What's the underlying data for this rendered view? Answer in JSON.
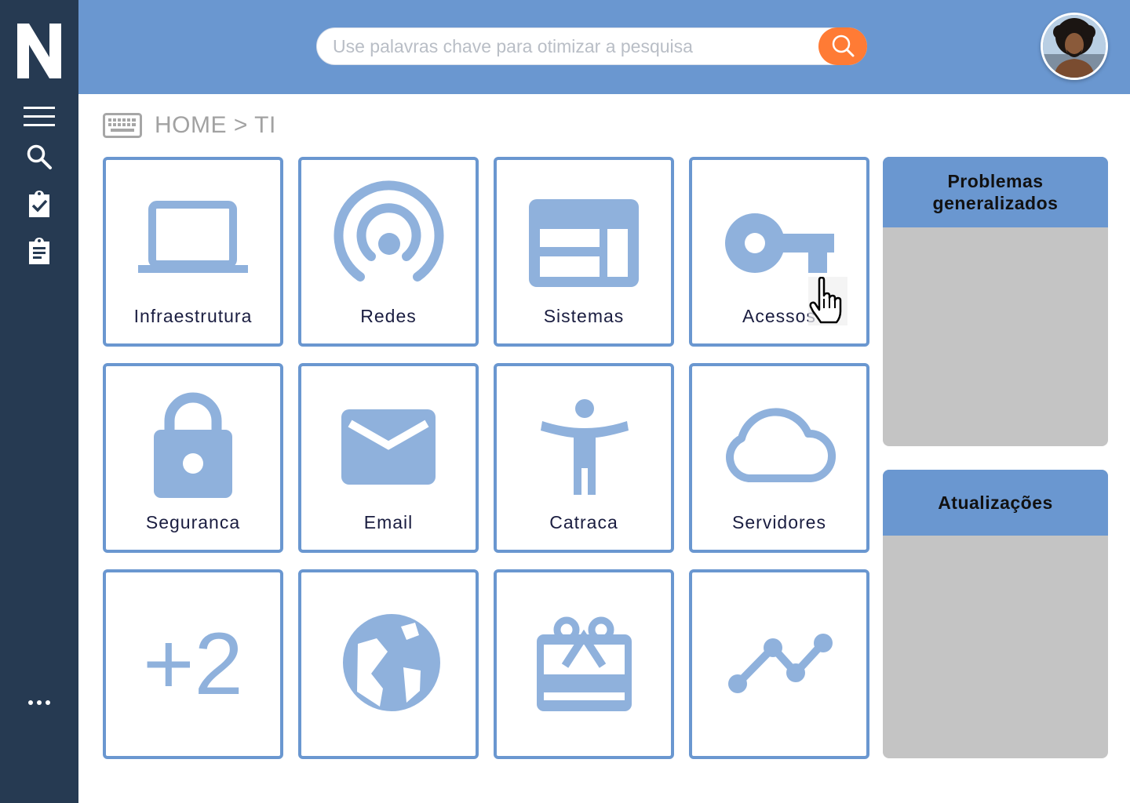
{
  "app": {
    "logo_letter": "N",
    "search_placeholder": "Use palavras chave para otimizar a pesquisa"
  },
  "sidebar": {
    "items": [
      {
        "icon": "menu-icon"
      },
      {
        "icon": "search-icon"
      },
      {
        "icon": "clipboard-check-icon"
      },
      {
        "icon": "clipboard-list-icon"
      },
      {
        "icon": "more-dots-icon"
      }
    ]
  },
  "breadcrumb": {
    "icon": "keyboard-icon",
    "text": "HOME > TI"
  },
  "tiles": [
    {
      "label": "Infraestrutura",
      "icon": "laptop-icon"
    },
    {
      "label": "Redes",
      "icon": "wifi-signal-icon"
    },
    {
      "label": "Sistemas",
      "icon": "web-layout-icon"
    },
    {
      "label": "Acessos",
      "icon": "key-icon"
    },
    {
      "label": "Seguranca",
      "icon": "lock-icon"
    },
    {
      "label": "Email",
      "icon": "mail-icon"
    },
    {
      "label": "Catraca",
      "icon": "accessibility-icon"
    },
    {
      "label": "Servidores",
      "icon": "cloud-icon"
    },
    {
      "label": "+2",
      "icon": "plus-two-icon"
    },
    {
      "label": "",
      "icon": "globe-icon"
    },
    {
      "label": "",
      "icon": "gift-card-icon"
    },
    {
      "label": "",
      "icon": "trending-line-icon"
    }
  ],
  "panels": {
    "problems_title": "Problemas generalizados",
    "updates_title": "Atualizações"
  },
  "colors": {
    "sidebar": "#263a52",
    "topbar": "#6a97d0",
    "tile_border": "#6a97d0",
    "tile_icon": "#8fb1dc",
    "search_button": "#ff7b35",
    "panel_body": "#c4c4c4"
  }
}
